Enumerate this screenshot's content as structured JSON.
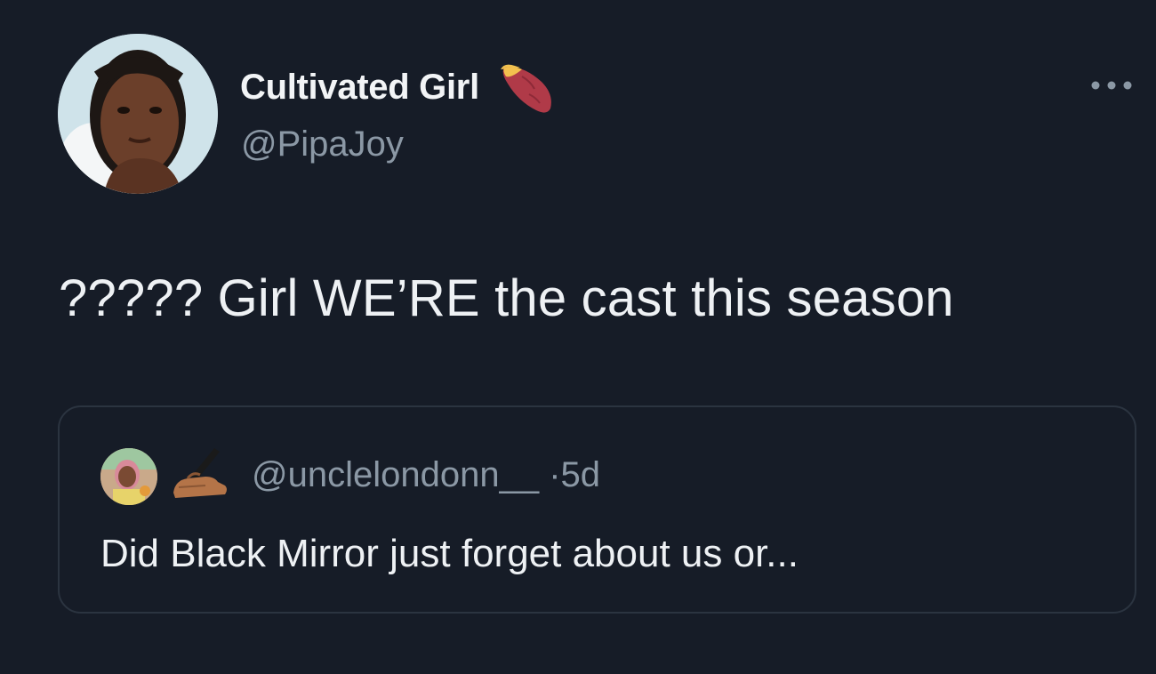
{
  "tweet": {
    "author": {
      "display_name": "Cultivated Girl",
      "handle": "@PipaJoy",
      "name_emoji": "sweet-potato-icon"
    },
    "more_icon": "more-options-icon",
    "text": "????? Girl WE’RE the cast this season",
    "quoted": {
      "handle": "@unclelondonn__",
      "separator": "·",
      "time": "5d",
      "name_emoji": "writing-hand-icon",
      "text": "Did Black Mirror just forget about us or..."
    }
  },
  "colors": {
    "background": "#161c27",
    "text_primary": "#eef1f4",
    "text_secondary": "#8b98a5",
    "border": "#2b3440"
  }
}
